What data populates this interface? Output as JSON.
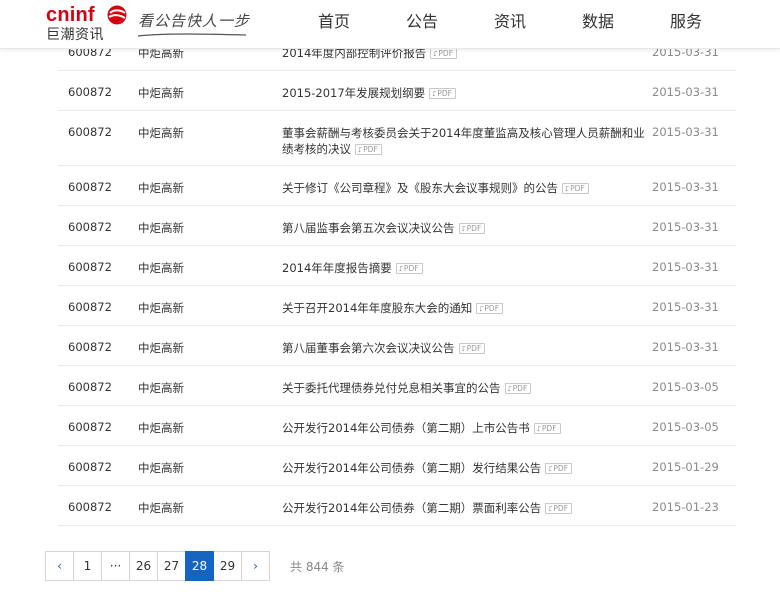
{
  "brand": {
    "logo_en": "cninf",
    "logo_cn": "巨潮资讯",
    "slogan": "看公告快人一步",
    "color": "#d7000f"
  },
  "nav": [
    {
      "label": "首页"
    },
    {
      "label": "公告"
    },
    {
      "label": "资讯"
    },
    {
      "label": "数据"
    },
    {
      "label": "服务"
    }
  ],
  "table": {
    "pdf_label": "PDF",
    "rows": [
      {
        "code": "600872",
        "name": "中炬高新",
        "title": "2014年度内部控制评价报告",
        "date": "2015-03-31"
      },
      {
        "code": "600872",
        "name": "中炬高新",
        "title": "2015-2017年发展规划纲要",
        "date": "2015-03-31"
      },
      {
        "code": "600872",
        "name": "中炬高新",
        "title": "董事会薪酬与考核委员会关于2014年度董监高及核心管理人员薪酬和业绩考核的决议",
        "date": "2015-03-31"
      },
      {
        "code": "600872",
        "name": "中炬高新",
        "title": "关于修订《公司章程》及《股东大会议事规则》的公告",
        "date": "2015-03-31"
      },
      {
        "code": "600872",
        "name": "中炬高新",
        "title": "第八届监事会第五次会议决议公告",
        "date": "2015-03-31"
      },
      {
        "code": "600872",
        "name": "中炬高新",
        "title": "2014年年度报告摘要",
        "date": "2015-03-31"
      },
      {
        "code": "600872",
        "name": "中炬高新",
        "title": "关于召开2014年年度股东大会的通知",
        "date": "2015-03-31"
      },
      {
        "code": "600872",
        "name": "中炬高新",
        "title": "第八届董事会第六次会议决议公告",
        "date": "2015-03-31"
      },
      {
        "code": "600872",
        "name": "中炬高新",
        "title": "关于委托代理债券兑付兑息相关事宜的公告",
        "date": "2015-03-05"
      },
      {
        "code": "600872",
        "name": "中炬高新",
        "title": "公开发行2014年公司债券（第二期）上市公告书",
        "date": "2015-03-05"
      },
      {
        "code": "600872",
        "name": "中炬高新",
        "title": "公开发行2014年公司债券（第二期）发行结果公告",
        "date": "2015-01-29"
      },
      {
        "code": "600872",
        "name": "中炬高新",
        "title": "公开发行2014年公司债券（第二期）票面利率公告",
        "date": "2015-01-23"
      }
    ]
  },
  "pagination": {
    "prev": "‹",
    "next": "›",
    "pages": [
      "1",
      "···",
      "26",
      "27",
      "28",
      "29"
    ],
    "active": "28",
    "total_text": "共 844 条",
    "accent": "#1565c0"
  }
}
